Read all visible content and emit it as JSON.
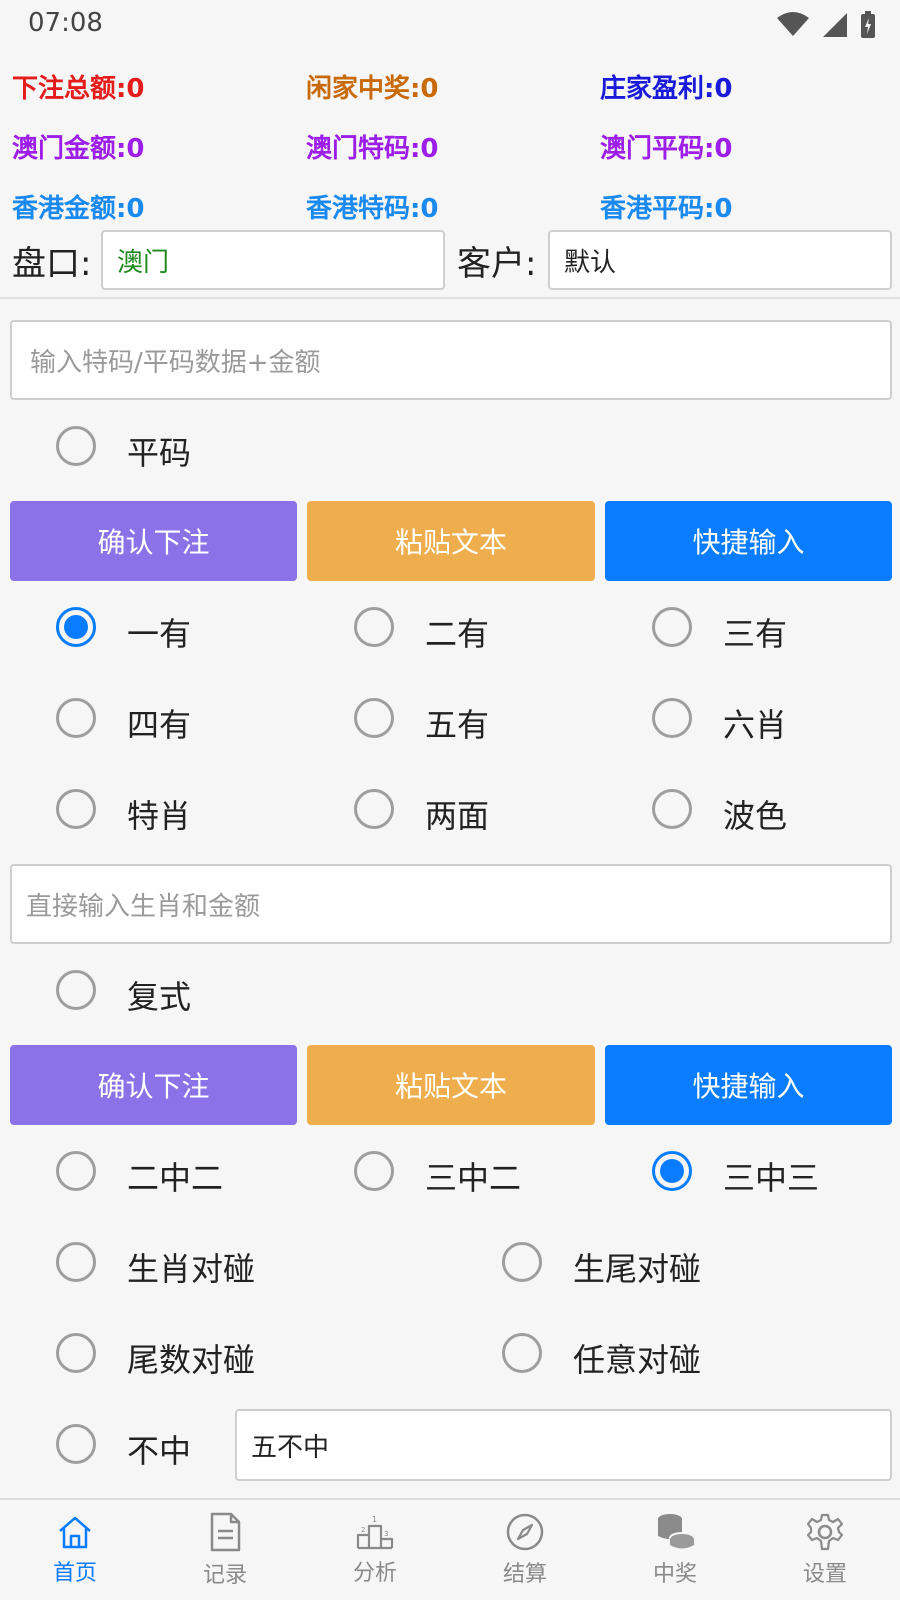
{
  "status": {
    "time": "07:08"
  },
  "stats": [
    {
      "text": "下注总额:0",
      "color": "#e51c1c"
    },
    {
      "text": "闲家中奖:0",
      "color": "#c8690a"
    },
    {
      "text": "庄家盈利:0",
      "color": "#1a1adb"
    },
    {
      "text": "澳门金额:0",
      "color": "#9c1ee8"
    },
    {
      "text": "澳门特码:0",
      "color": "#9c1ee8"
    },
    {
      "text": "澳门平码:0",
      "color": "#9c1ee8"
    },
    {
      "text": "香港金额:0",
      "color": "#1a8af0"
    },
    {
      "text": "香港特码:0",
      "color": "#1a8af0"
    },
    {
      "text": "香港平码:0",
      "color": "#1a8af0"
    }
  ],
  "market": {
    "label": "盘口:",
    "value": "澳门",
    "value_color": "#1f8a1f"
  },
  "customer": {
    "label": "客户:",
    "value": "默认"
  },
  "section1": {
    "input_placeholder": "输入特码/平码数据+金额",
    "radio_label": "平码",
    "buttons": [
      "确认下注",
      "粘贴文本",
      "快捷输入"
    ],
    "options": [
      "一有",
      "二有",
      "三有",
      "四有",
      "五有",
      "六肖",
      "特肖",
      "两面",
      "波色"
    ],
    "selected": "一有"
  },
  "section2": {
    "input_placeholder": "直接输入生肖和金额",
    "radio_label": "复式",
    "buttons": [
      "确认下注",
      "粘贴文本",
      "快捷输入"
    ],
    "options_row1": [
      "二中二",
      "三中二",
      "三中三"
    ],
    "selected": "三中三",
    "options_pairs": [
      "生肖对碰",
      "生尾对碰",
      "尾数对碰",
      "任意对碰"
    ],
    "buzhong_label": "不中",
    "buzhong_value": "五不中"
  },
  "tabs": [
    {
      "label": "首页",
      "icon": "home-icon",
      "active": true
    },
    {
      "label": "记录",
      "icon": "document-icon",
      "active": false
    },
    {
      "label": "分析",
      "icon": "podium-icon",
      "active": false
    },
    {
      "label": "结算",
      "icon": "compass-icon",
      "active": false
    },
    {
      "label": "中奖",
      "icon": "coins-icon",
      "active": false
    },
    {
      "label": "设置",
      "icon": "gear-icon",
      "active": false
    }
  ],
  "colors": {
    "accent": "#0a7cff",
    "purple": "#8b72e8",
    "orange": "#efae4e"
  }
}
